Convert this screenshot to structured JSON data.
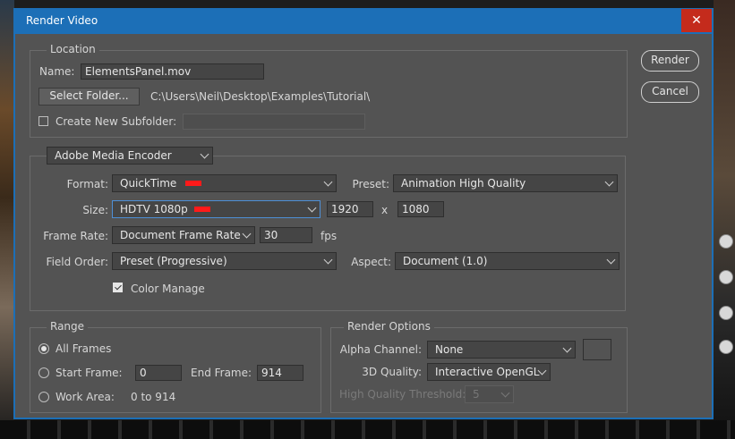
{
  "window": {
    "title": "Render Video",
    "close_glyph": "✕"
  },
  "location": {
    "group_label": "Location",
    "name_label": "Name:",
    "name_value": "ElementsPanel.mov",
    "select_folder_label": "Select Folder...",
    "folder_path": "C:\\Users\\Neil\\Desktop\\Examples\\Tutorial\\",
    "subfolder_label": "Create New Subfolder:",
    "subfolder_checked": false,
    "subfolder_value": ""
  },
  "actions": {
    "render_label": "Render",
    "cancel_label": "Cancel"
  },
  "encoder": {
    "selected": "Adobe Media Encoder",
    "format_label": "Format:",
    "format_value": "QuickTime",
    "preset_label": "Preset:",
    "preset_value": "Animation High Quality",
    "size_label": "Size:",
    "size_value": "HDTV 1080p",
    "width_value": "1920",
    "size_x": "x",
    "height_value": "1080",
    "frame_rate_label": "Frame Rate:",
    "frame_rate_value": "Document Frame Rate",
    "fps_value": "30",
    "fps_unit": "fps",
    "field_order_label": "Field Order:",
    "field_order_value": "Preset (Progressive)",
    "aspect_label": "Aspect:",
    "aspect_value": "Document (1.0)",
    "color_manage_label": "Color Manage",
    "color_manage_checked": true
  },
  "range": {
    "group_label": "Range",
    "all_frames_label": "All Frames",
    "start_frame_label": "Start Frame:",
    "start_frame_value": "0",
    "end_frame_label": "End Frame:",
    "end_frame_value": "914",
    "work_area_label": "Work Area:",
    "work_area_value": "0 to 914",
    "selected": "All Frames"
  },
  "render_options": {
    "group_label": "Render Options",
    "alpha_label": "Alpha Channel:",
    "alpha_value": "None",
    "quality_label": "3D Quality:",
    "quality_value": "Interactive OpenGL",
    "threshold_label": "High Quality Threshold:",
    "threshold_value": "5"
  },
  "colors": {
    "title_bar": "#1c6fb7",
    "panel": "#535353",
    "close": "#c42b1c",
    "marker": "#ff1a1a"
  }
}
